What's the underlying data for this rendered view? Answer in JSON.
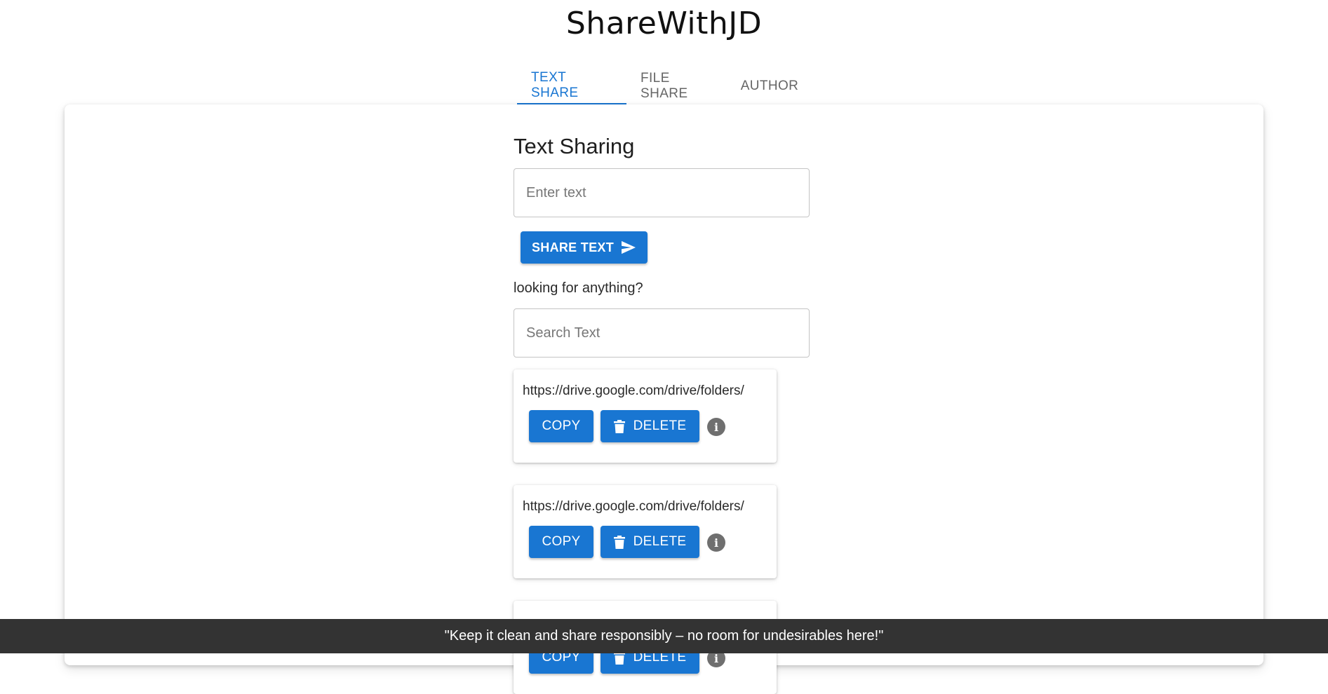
{
  "app": {
    "title": "ShareWithJD"
  },
  "tabs": [
    {
      "label": "TEXT SHARE",
      "active": true
    },
    {
      "label": "FILE SHARE",
      "active": false
    },
    {
      "label": "AUTHOR",
      "active": false
    }
  ],
  "text_sharing": {
    "heading": "Text Sharing",
    "input_placeholder": "Enter text",
    "share_button_label": "SHARE TEXT",
    "search_prompt": "looking for anything?",
    "search_placeholder": "Search Text"
  },
  "items": [
    {
      "text": "https://drive.google.com/drive/folders/",
      "copy_label": "COPY",
      "delete_label": "DELETE"
    },
    {
      "text": "https://drive.google.com/drive/folders/",
      "copy_label": "COPY",
      "delete_label": "DELETE"
    },
    {
      "text": "",
      "copy_label": "COPY",
      "delete_label": "DELETE"
    }
  ],
  "footer": {
    "text": "\"Keep it clean and share responsibly – no room for undesirables here!\""
  },
  "colors": {
    "primary": "#1976d2",
    "footer_bg": "#333333",
    "info_icon": "#6f6f6f"
  }
}
